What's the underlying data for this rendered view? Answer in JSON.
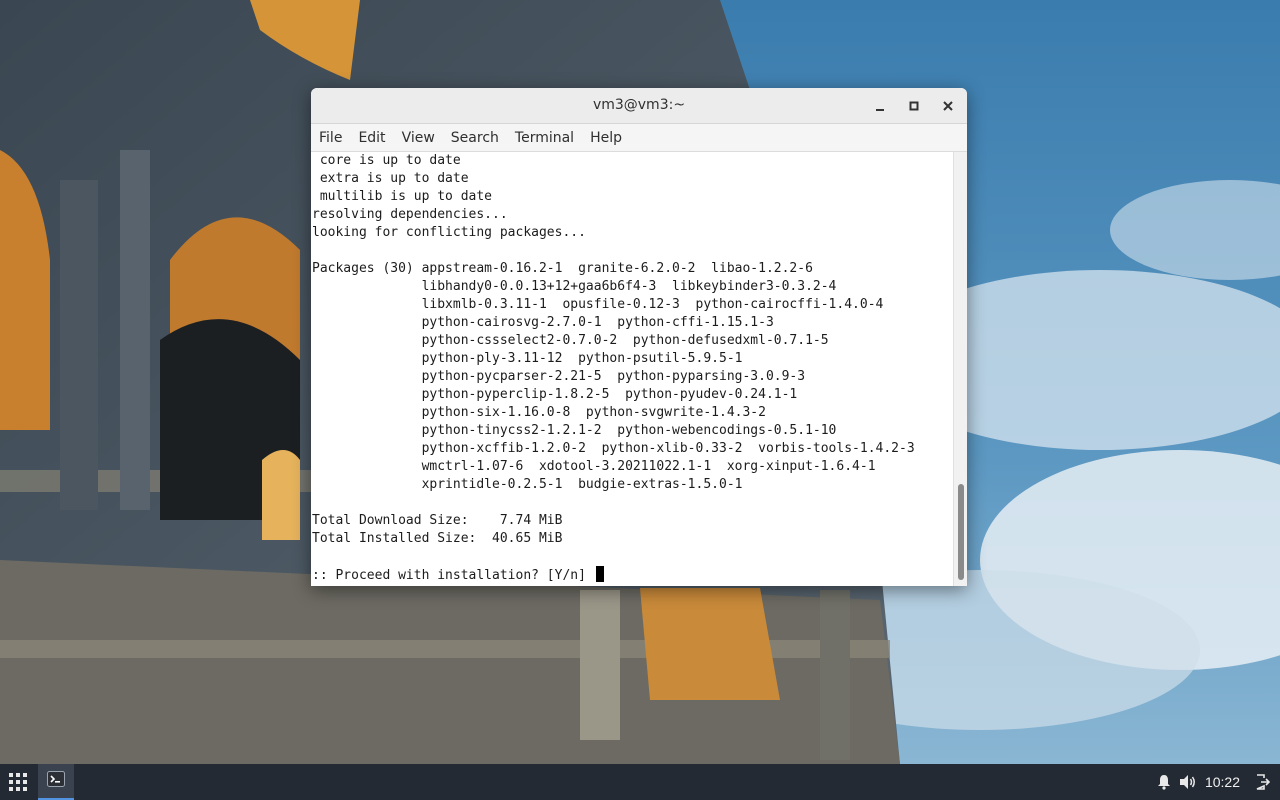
{
  "window": {
    "title": "vm3@vm3:~",
    "buttons": {
      "minimize_icon": "minimize-icon",
      "maximize_icon": "maximize-icon",
      "close_icon": "close-icon"
    }
  },
  "menubar": {
    "items": [
      "File",
      "Edit",
      "View",
      "Search",
      "Terminal",
      "Help"
    ]
  },
  "terminal": {
    "lines": [
      " core is up to date",
      " extra is up to date",
      " multilib is up to date",
      "resolving dependencies...",
      "looking for conflicting packages...",
      "",
      "Packages (30) appstream-0.16.2-1  granite-6.2.0-2  libao-1.2.2-6",
      "              libhandy0-0.0.13+12+gaa6b6f4-3  libkeybinder3-0.3.2-4",
      "              libxmlb-0.3.11-1  opusfile-0.12-3  python-cairocffi-1.4.0-4",
      "              python-cairosvg-2.7.0-1  python-cffi-1.15.1-3",
      "              python-cssselect2-0.7.0-2  python-defusedxml-0.7.1-5",
      "              python-ply-3.11-12  python-psutil-5.9.5-1",
      "              python-pycparser-2.21-5  python-pyparsing-3.0.9-3",
      "              python-pyperclip-1.8.2-5  python-pyudev-0.24.1-1",
      "              python-six-1.16.0-8  python-svgwrite-1.4.3-2",
      "              python-tinycss2-1.2.1-2  python-webencodings-0.5.1-10",
      "              python-xcffib-1.2.0-2  python-xlib-0.33-2  vorbis-tools-1.4.2-3",
      "              wmctrl-1.07-6  xdotool-3.20211022.1-1  xorg-xinput-1.6.4-1",
      "              xprintidle-0.2.5-1  budgie-extras-1.5.0-1",
      "",
      "Total Download Size:    7.74 MiB",
      "Total Installed Size:  40.65 MiB",
      ""
    ],
    "prompt": ":: Proceed with installation? [Y/n] "
  },
  "taskbar": {
    "apps_icon": "app-grid-icon",
    "task_icon": "terminal-icon",
    "clock": "10:22",
    "tray_icons": [
      "notification-bell-icon",
      "volume-icon",
      "logout-icon"
    ]
  }
}
